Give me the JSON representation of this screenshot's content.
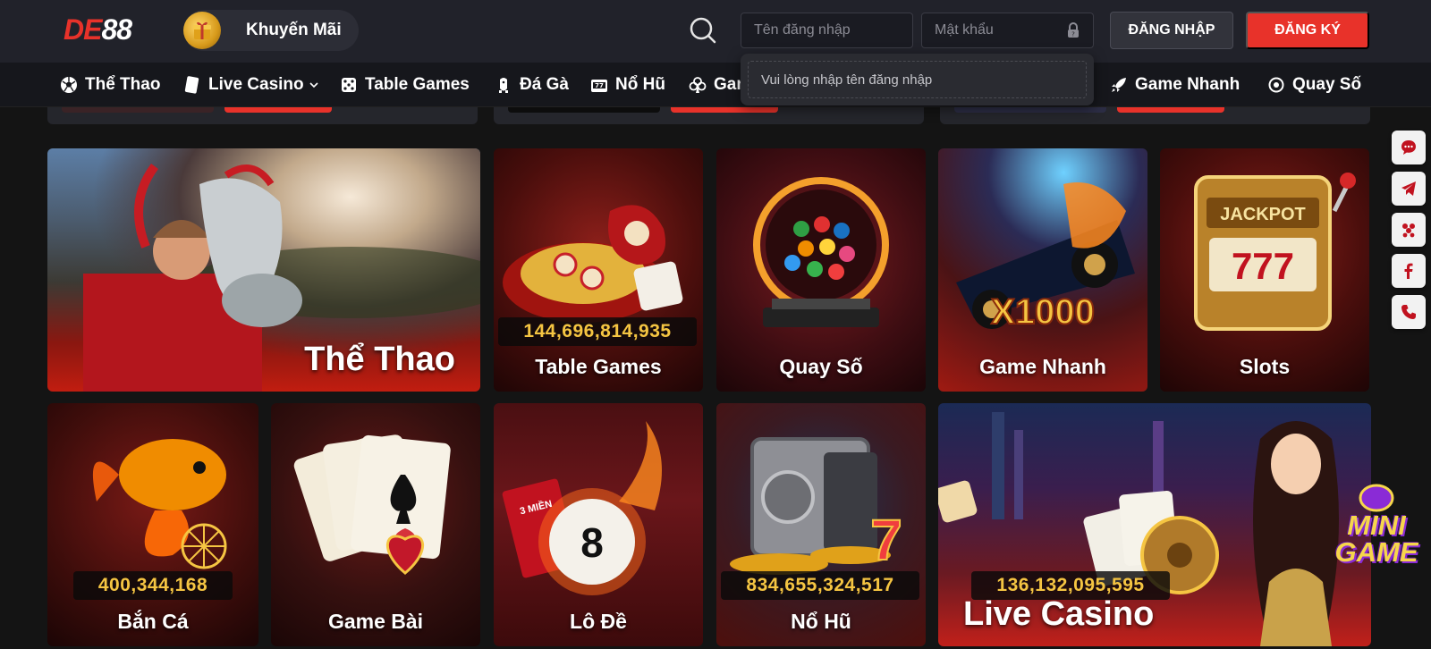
{
  "header": {
    "logo_de": "DE",
    "logo_num": "88",
    "promo_label": "Khuyến Mãi",
    "username_placeholder": "Tên đăng nhập",
    "password_placeholder": "Mật khẩu",
    "login_label": "ĐĂNG NHẬP",
    "register_label": "ĐĂNG KÝ",
    "tooltip": "Vui lòng nhập tên đăng nhập"
  },
  "nav": {
    "items": [
      {
        "label": "Thể Thao",
        "icon": "soccer-ball-icon"
      },
      {
        "label": "Live Casino",
        "icon": "card-icon"
      },
      {
        "label": "Table Games",
        "icon": "dice-icon"
      },
      {
        "label": "Đá Gà",
        "icon": "rooster-icon"
      },
      {
        "label": "Nổ Hũ",
        "icon": "slot-icon"
      },
      {
        "label": "Gar",
        "icon": "club-icon"
      },
      {
        "label": "Game Nhanh",
        "icon": "rocket-icon"
      },
      {
        "label": "Quay Số",
        "icon": "lottery-icon"
      }
    ],
    "live_casino_chevron": "chevron-down-icon"
  },
  "tiles": {
    "the_thao": {
      "label": "Thể Thao"
    },
    "table_games": {
      "label": "Table Games",
      "jackpot": "144,696,814,935"
    },
    "quay_so": {
      "label": "Quay Số"
    },
    "game_nhanh": {
      "label": "Game Nhanh",
      "art_text": "X1000"
    },
    "slots": {
      "label": "Slots",
      "art_text": "JACKPOT",
      "reels": "777"
    },
    "ban_ca": {
      "label": "Bắn Cá",
      "jackpot": "400,344,168"
    },
    "game_bai": {
      "label": "Game Bài"
    },
    "lo_de": {
      "label": "Lô Đề",
      "art_text": "3 MIỀN",
      "ball": "8"
    },
    "no_hu": {
      "label": "Nổ Hũ",
      "jackpot": "834,655,324,517"
    },
    "live_casino": {
      "label": "Live Casino",
      "jackpot": "136,132,095,595"
    }
  },
  "floating": [
    "chat-icon",
    "telegram-icon",
    "messenger-icon",
    "facebook-icon",
    "phone-icon"
  ],
  "mini_game": "MINI GAME",
  "colors": {
    "brand_red": "#e8322a",
    "gold": "#f5c542",
    "header_bg": "#21222a"
  }
}
